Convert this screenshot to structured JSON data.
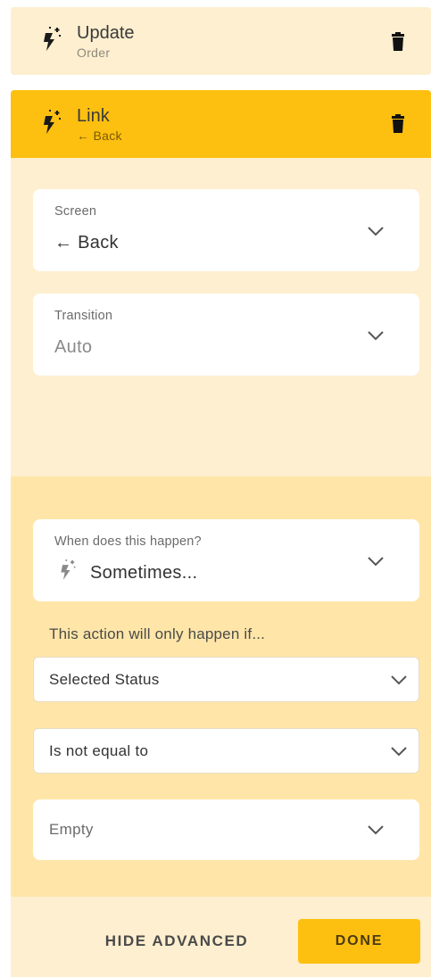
{
  "actions": [
    {
      "title": "Update",
      "subtitle": "Order",
      "icon": "magic-bolt-icon",
      "delete_icon": "trash-icon"
    },
    {
      "title": "Link",
      "subtitle": "← Back",
      "icon": "magic-bolt-icon",
      "delete_icon": "trash-icon",
      "expanded": true
    }
  ],
  "link_settings": {
    "screen": {
      "label": "Screen",
      "value": "← Back"
    },
    "transition": {
      "label": "Transition",
      "value": "Auto"
    }
  },
  "advanced": {
    "when": {
      "label": "When does this happen?",
      "value": "Sometimes...",
      "icon": "magic-bolt-icon"
    },
    "helper_text": "This action will only happen if...",
    "condition": {
      "field": "Selected Status",
      "operator": "Is not equal to",
      "value": "Empty"
    }
  },
  "footer": {
    "hide_advanced_label": "HIDE ADVANCED",
    "done_label": "DONE"
  },
  "colors": {
    "accent": "#fec010",
    "panel": "#fdefcf",
    "advanced_panel": "#ffe6a8"
  }
}
